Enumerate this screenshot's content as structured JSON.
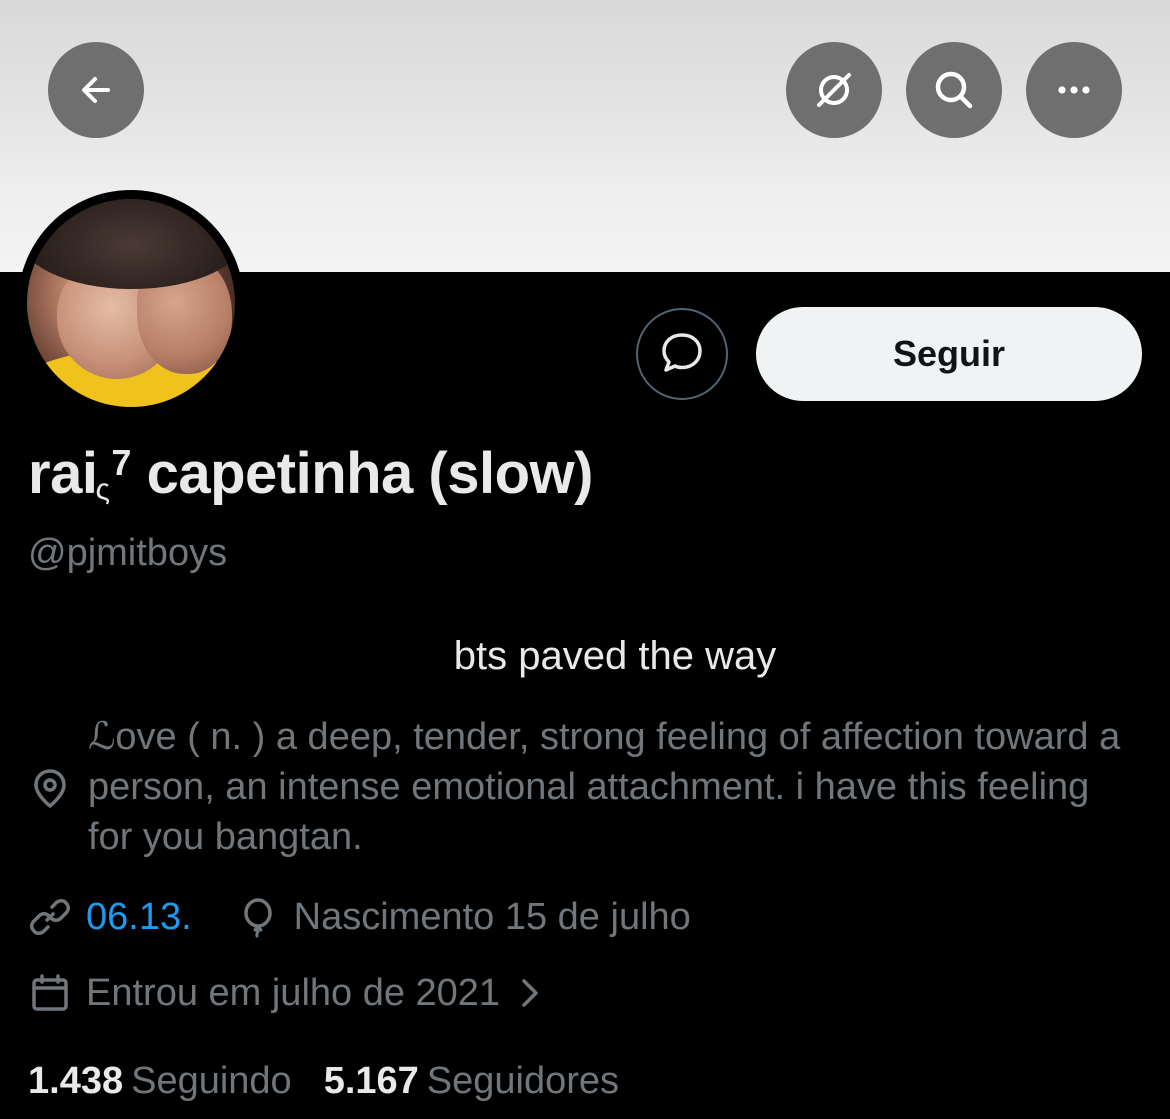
{
  "header": {
    "back_icon": "arrow-left-icon",
    "grok_icon": "grok-icon",
    "search_icon": "search-icon",
    "more_icon": "more-horizontal-icon"
  },
  "profile": {
    "display_name_main": "rai",
    "display_name_sub": "ς",
    "display_name_sup": "7",
    "display_name_rest": " capetinha (slow)",
    "handle": "@pjmitboys",
    "bio": "bts paved the way",
    "location": "ℒove ( n. ) a deep, tender, strong feeling of affection toward a person, an intense emotional attachment. i have this feeling for you bangtan.",
    "website": "06.13.",
    "birthday": "Nascimento 15 de julho",
    "joined": "Entrou em julho de 2021"
  },
  "actions": {
    "follow_label": "Seguir",
    "message_icon": "message-bubble-icon"
  },
  "stats": {
    "following_count": "1.438",
    "following_label": "Seguindo",
    "followers_count": "5.167",
    "followers_label": "Seguidores"
  },
  "colors": {
    "background": "#000000",
    "link": "#1d9bf0",
    "muted": "#71767b",
    "avatar_shirt": "#efc21e"
  }
}
